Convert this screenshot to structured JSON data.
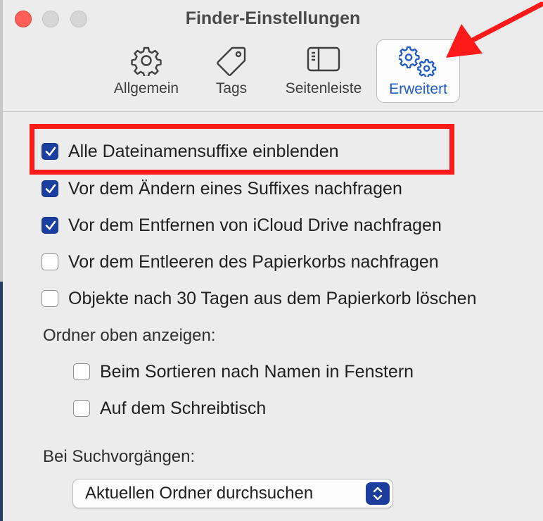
{
  "window": {
    "title": "Finder-Einstellungen"
  },
  "tabs": [
    {
      "label": "Allgemein",
      "icon": "gear-icon",
      "selected": false
    },
    {
      "label": "Tags",
      "icon": "tag-icon",
      "selected": false
    },
    {
      "label": "Seitenleiste",
      "icon": "sidebar-icon",
      "selected": false
    },
    {
      "label": "Erweitert",
      "icon": "gears-icon",
      "selected": true
    }
  ],
  "options": [
    {
      "label": "Alle Dateinamensuffixe einblenden",
      "checked": true
    },
    {
      "label": "Vor dem Ändern eines Suffixes nachfragen",
      "checked": true
    },
    {
      "label": "Vor dem Entfernen von iCloud Drive nachfragen",
      "checked": true
    },
    {
      "label": "Vor dem Entleeren des Papierkorbs nachfragen",
      "checked": false
    },
    {
      "label": "Objekte nach 30 Tagen aus dem Papierkorb löschen",
      "checked": false
    }
  ],
  "folders_on_top": {
    "heading": "Ordner oben anzeigen:",
    "options": [
      {
        "label": "Beim Sortieren nach Namen in Fenstern",
        "checked": false
      },
      {
        "label": "Auf dem Schreibtisch",
        "checked": false
      }
    ]
  },
  "search": {
    "heading": "Bei Suchvorgängen:",
    "selected": "Aktuellen Ordner durchsuchen"
  },
  "colors": {
    "accent": "#1e5bc6",
    "checkbox": "#1a3fa0",
    "annotation": "#ff1a1a",
    "close": "#ff5f57"
  }
}
